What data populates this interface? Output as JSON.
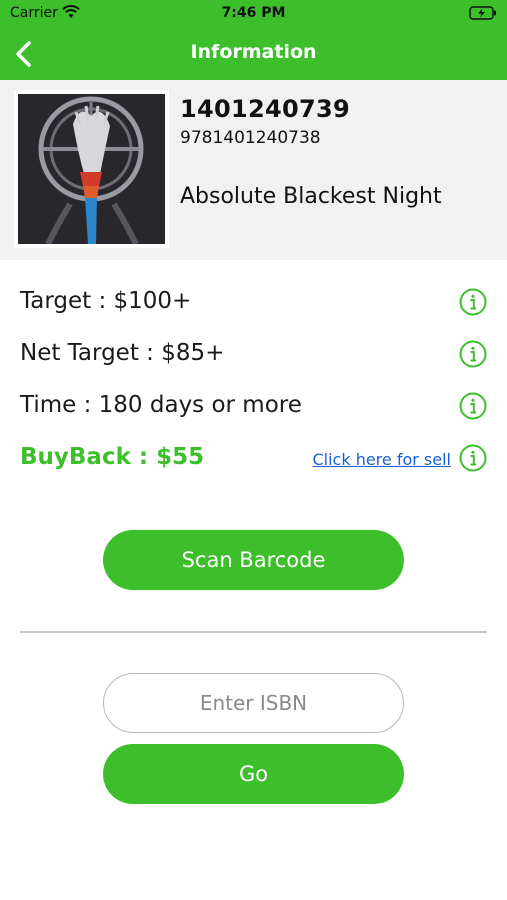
{
  "status_bar": {
    "carrier": "Carrier",
    "time": "7:46 PM"
  },
  "nav": {
    "title": "Information"
  },
  "book": {
    "isbn10": "1401240739",
    "isbn13": "9781401240738",
    "title": "Absolute Blackest Night"
  },
  "info": {
    "target": "Target : $100+",
    "net_target": "Net Target : $85+",
    "time": "Time : 180 days or more",
    "buyback": "BuyBack : $55",
    "sell_link": "Click here for sell"
  },
  "actions": {
    "scan_label": "Scan Barcode",
    "isbn_placeholder": "Enter ISBN",
    "go_label": "Go"
  },
  "colors": {
    "brand_green": "#3dbf2c",
    "link_blue": "#1b5fd6"
  },
  "icons": [
    "wifi-icon",
    "battery-charging-icon",
    "back-chevron-icon",
    "info-icon"
  ]
}
